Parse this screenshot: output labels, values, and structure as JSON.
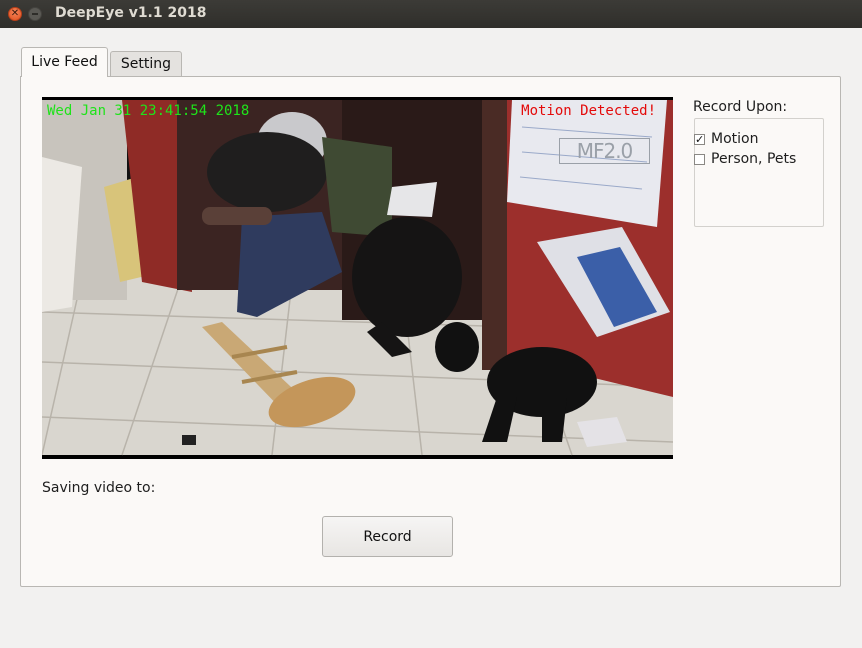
{
  "window": {
    "title": "DeepEye v1.1 2018"
  },
  "tabs": [
    {
      "label": "Live Feed",
      "active": true
    },
    {
      "label": "Setting",
      "active": false
    }
  ],
  "video": {
    "timestamp": "Wed Jan 31 23:41:54 2018",
    "status": "Motion Detected!",
    "watermark": "MF2.0"
  },
  "saving_label": "Saving video to:",
  "record_button": "Record",
  "record_upon": {
    "label": "Record Upon:",
    "options": [
      {
        "label": "Motion",
        "checked": true
      },
      {
        "label": "Person, Pets",
        "checked": false
      }
    ]
  },
  "colors": {
    "titlebar": "#3c3b37",
    "close_button": "#e9541f",
    "timestamp_osd": "#1fe31a",
    "motion_osd": "#e40a0a"
  }
}
